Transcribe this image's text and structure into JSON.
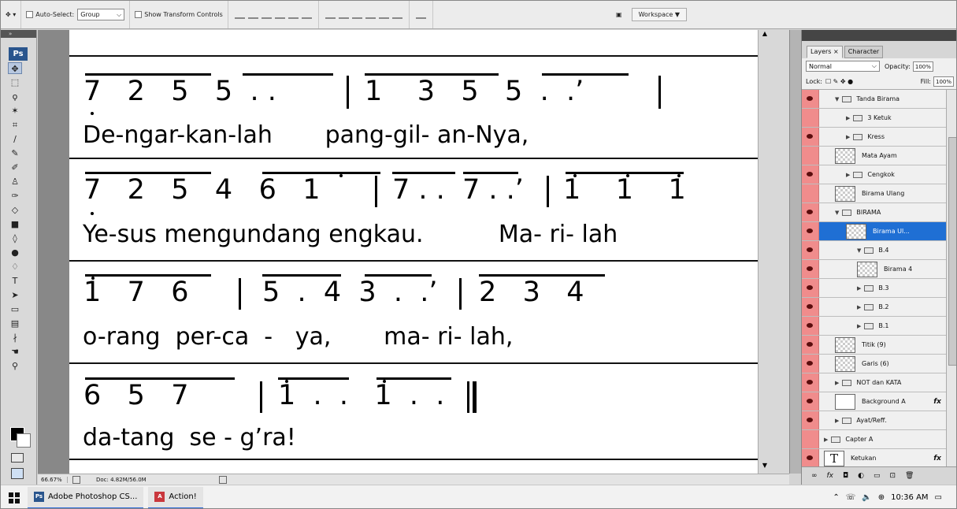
{
  "options_bar": {
    "auto_select_label": "Auto-Select:",
    "auto_select_value": "Group",
    "transform_label": "Show Transform Controls",
    "workspace_label": "Workspace ▼"
  },
  "tools": {
    "logo": "Ps"
  },
  "score": {
    "rows": [
      {
        "notes": "7   2   5   5  . .",
        "notes2": "1    3   5   5  .  .’",
        "lyrics": "De-ngar-kan-lah       pang-gil- an-Nya,"
      },
      {
        "notes": "7   2   5   4   6   1",
        "notes2": "7 . .  7 . .’",
        "notes3": "1    1    1",
        "lyrics": "Ye-sus mengundang engkau.          Ma- ri- lah"
      },
      {
        "notes": "1   7   6",
        "notes2": "5  .  4  3  .  .’",
        "notes3": "2   3   4",
        "lyrics": "o-rang  per-ca  -   ya,       ma- ri- lah,"
      },
      {
        "notes": "6   5   7",
        "notes2": "1  .  .   1  .  .",
        "lyrics": "da-tang  se - g’ra!"
      }
    ]
  },
  "status": {
    "zoom": "66.67%",
    "doc_info": "Doc: 4.82M/56.0M"
  },
  "layers_panel": {
    "tab_layers": "Layers ×",
    "tab_character": "Character",
    "blend_mode": "Normal",
    "opacity_label": "Opacity:",
    "opacity_value": "100%",
    "lock_label": "Lock:",
    "fill_label": "Fill:",
    "fill_value": "100%",
    "layers": [
      {
        "name": "Tanda Birama",
        "kind": "group",
        "indent": 1,
        "open": true,
        "eye": true
      },
      {
        "name": "3 Ketuk",
        "kind": "group",
        "indent": 2,
        "open": false,
        "eye": false
      },
      {
        "name": "Kress",
        "kind": "group",
        "indent": 2,
        "open": false,
        "eye": true
      },
      {
        "name": "Mata Ayam",
        "kind": "layer",
        "indent": 1,
        "eye": false
      },
      {
        "name": "Cengkok",
        "kind": "group",
        "indent": 2,
        "open": false,
        "eye": true
      },
      {
        "name": "Birama Ulang",
        "kind": "layer",
        "indent": 1,
        "eye": false
      },
      {
        "name": "BIRAMA",
        "kind": "group",
        "indent": 1,
        "open": true,
        "eye": true
      },
      {
        "name": "Birama Ul...",
        "kind": "layer",
        "indent": 2,
        "eye": true,
        "selected": true
      },
      {
        "name": "B.4",
        "kind": "group",
        "indent": 3,
        "open": true,
        "eye": true
      },
      {
        "name": "Birama 4",
        "kind": "layer",
        "indent": 3,
        "eye": true
      },
      {
        "name": "B.3",
        "kind": "group",
        "indent": 3,
        "open": false,
        "eye": true
      },
      {
        "name": "B.2",
        "kind": "group",
        "indent": 3,
        "open": false,
        "eye": true
      },
      {
        "name": "B.1",
        "kind": "group",
        "indent": 3,
        "open": false,
        "eye": true
      },
      {
        "name": "Titik (9)",
        "kind": "layer",
        "indent": 1,
        "eye": true
      },
      {
        "name": "Garis (6)",
        "kind": "layer",
        "indent": 1,
        "eye": true
      },
      {
        "name": "NOT dan KATA",
        "kind": "group",
        "indent": 1,
        "open": false,
        "eye": true
      },
      {
        "name": "Background A",
        "kind": "layer",
        "indent": 1,
        "eye": true,
        "fx": "fx",
        "plain": true
      },
      {
        "name": "Ayat/Reff.",
        "kind": "group",
        "indent": 1,
        "open": false,
        "eye": true
      },
      {
        "name": "Capter A",
        "kind": "group",
        "indent": 0,
        "open": false,
        "eye": false
      },
      {
        "name": "Ketukan",
        "kind": "text",
        "indent": 0,
        "eye": true,
        "fx": "fx"
      }
    ]
  },
  "taskbar": {
    "tasks": [
      "Adobe Photoshop CS...",
      "Action!"
    ],
    "time": "10:36 AM"
  }
}
